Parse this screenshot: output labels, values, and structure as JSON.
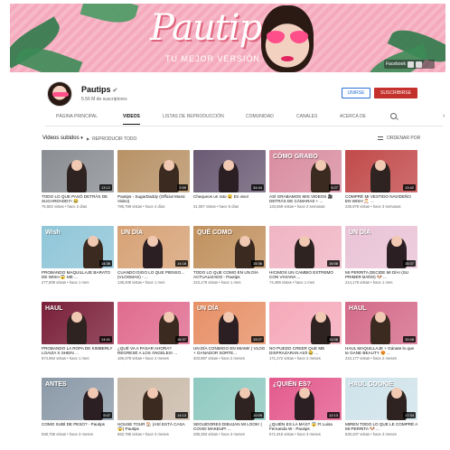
{
  "banner": {
    "brand": "Pautips",
    "tagline": "TU MEJOR VERSIÓN",
    "social_label": "Facebook"
  },
  "channel": {
    "name": "Pautips",
    "verified_icon": "check-icon",
    "subscribers": "5.56 M de suscriptores",
    "join_label": "UNIRSE",
    "subscribe_label": "SUSCRIBIRSE"
  },
  "tabs": [
    {
      "label": "PÁGINA PRINCIPAL"
    },
    {
      "label": "VIDEOS"
    },
    {
      "label": "LISTAS DE REPRODUCCIÓN"
    },
    {
      "label": "COMUNIDAD"
    },
    {
      "label": "CANALES"
    },
    {
      "label": "ACERCA DE"
    }
  ],
  "section": {
    "title": "Videos subidos",
    "play_all": "REPRODUCIR TODO",
    "sort": "ORDENAR POR"
  },
  "videos": [
    {
      "title": "TODO LO QUE PASÓ DETRÁS DE SUGARDADDY! 😂",
      "meta": "75,592 vistas • hace 2 días",
      "duration": "13:12",
      "overlay": "",
      "bg": "#8a8d92",
      "fig": "#2e2320"
    },
    {
      "title": "Pautips - SugarDaddy (Official Music Video)",
      "meta": "786,786 vistas • hace 4 días",
      "duration": "2:59",
      "overlay": "",
      "bg": "#b89266",
      "fig": "#3a2a1f"
    },
    {
      "title": "Chequeos un rato 😄 En vivo!",
      "meta": "31,087 vistas • hace 6 días",
      "duration": "34:44",
      "overlay": "",
      "bg": "#6a5a73",
      "fig": "#2c1f24"
    },
    {
      "title": "ASÍ GRABAMOS MIS VIDEOS 🎥 DETRÁS DE CÁMARAS + ...",
      "meta": "133,669 vistas • hace 2 semanas",
      "duration": "9:27",
      "overlay": "CÓMO GRABO",
      "bg": "#d98da0",
      "fig": "#3a2a1f"
    },
    {
      "title": "COMPRÉ MI VESTIDO NAVIDEÑO EN WISH 🎅 ...",
      "meta": "236,975 vistas • hace 3 semanas",
      "duration": "13:42",
      "overlay": "",
      "bg": "#c24a4a",
      "fig": "#2e2320"
    },
    {
      "title": "PROBANDO MAQUILLAJE BARATO DE WISH 😱 ME ...",
      "meta": "277,809 vistas • hace 1 mes",
      "duration": "14:36",
      "overlay": "Wish",
      "bg": "#8fc6d8",
      "fig": "#3a2a1f"
    },
    {
      "title": "CUANDO DIGO LO QUE PIENSO... (VLOGMAS) - ...",
      "meta": "136,409 vistas • hace 1 mes",
      "duration": "14:18",
      "overlay": "UN DÍA",
      "bg": "#d7a276",
      "fig": "#2c1f24"
    },
    {
      "title": "TODO LO QUE COMO EN UN DÍA ACTUALIZADO - Pautips",
      "meta": "223,179 vistas • hace 1 mes",
      "duration": "15:36",
      "overlay": "QUÉ COMO",
      "bg": "#c1915e",
      "fig": "#3a2a1f"
    },
    {
      "title": "HICIMOS UN CAMBIO EXTREMO CON VIVIANA ...",
      "meta": "74,499 vistas • hace 1 mes",
      "duration": "16:58",
      "overlay": "",
      "bg": "#f0b4c4",
      "fig": "#2e2320"
    },
    {
      "title": "MI PERRITA DECIDE MI DÍA! (SU PRIMER BAÑO) 🐶 ...",
      "meta": "214,176 vistas • hace 1 mes",
      "duration": "15:37",
      "overlay": "UN DÍA",
      "bg": "#e9c3d6",
      "fig": "#2c1f24"
    },
    {
      "title": "PROBANDO LA ROPA DE KIMBERLY LOAIZA X SHEIN ...",
      "meta": "874,964 vistas • hace 1 mes",
      "duration": "14:41",
      "overlay": "HAUL",
      "bg": "#7a1f3a",
      "fig": "#2e2320"
    },
    {
      "title": "¿QUÉ VA A PASAR AHORA? REGRESÉ A LOS ÁNGELES! ...",
      "meta": "169,378 vistas • hace 2 meses",
      "duration": "16:37",
      "overlay": "",
      "bg": "#e06b8f",
      "fig": "#3a2a1f"
    },
    {
      "title": "UN DÍA CONMIGO EN MIAMI! ( VLOG + GANADOR SORTE...",
      "meta": "403,887 vistas • hace 2 meses",
      "duration": "19:27",
      "overlay": "UN DÍA",
      "bg": "#e79066",
      "fig": "#2c1f24"
    },
    {
      "title": "NO PUEDO CREER QUE ME DISFRAZARAN ASÍ! 😂 ...",
      "meta": "171,272 vistas • hace 2 meses",
      "duration": "11:06",
      "overlay": "",
      "bg": "#f5a9b9",
      "fig": "#2e2320"
    },
    {
      "title": "HAUL MAQUILLAJE + Gánate lo que te GANE BEAUTY 😍 ...",
      "meta": "210,177 vistas • hace 2 meses",
      "duration": "10:48",
      "overlay": "HAUL",
      "bg": "#d46a8a",
      "fig": "#3a2a1f"
    },
    {
      "title": "COMO SUBÍ DE PESO? - Pautips",
      "meta": "938,756 vistas • hace 3 meses",
      "duration": "9:47",
      "overlay": "ANTES",
      "bg": "#8c9aa8",
      "fig": "#2c1f24"
    },
    {
      "title": "HOUSE TOUR 🏠 (ASÍ ESTÁ CASA 😱) Pautips",
      "meta": "682,786 vistas • hace 3 meses",
      "duration": "14:13",
      "overlay": "",
      "bg": "#c9b9a8",
      "fig": "#3a2a1f"
    },
    {
      "title": "SEGUIDORES DIBUJAN MI LOOK! | COVID MAKEUP! ...",
      "meta": "288,393 vistas • hace 3 meses",
      "duration": "10:09",
      "overlay": "",
      "bg": "#8ec9c0",
      "fig": "#2e2320"
    },
    {
      "title": "¿QUIÉN ES LA MÁS? 😱 Ft Luisa Fernanda W - Pautips",
      "meta": "571,915 vistas • hace 3 meses",
      "duration": "12:13",
      "overlay": "¿QUIÉN ES?",
      "bg": "#e35a8c",
      "fig": "#2c1f24"
    },
    {
      "title": "MIREN TODO LO QUE LE COMPRÉ A MI PERRITA 🐶 ...",
      "meta": "630,207 vistas • hace 3 meses",
      "duration": "17:34",
      "overlay": "HAUL COOKIE",
      "bg": "#cfe3ea",
      "fig": "#2e2320"
    }
  ]
}
